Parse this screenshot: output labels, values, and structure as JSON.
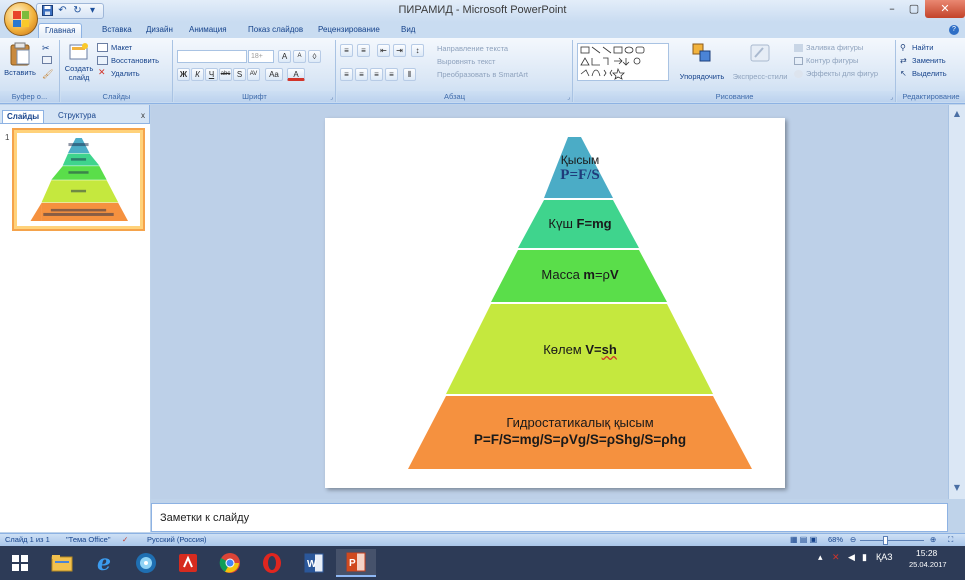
{
  "window": {
    "title": "ПИРАМИД - Microsoft PowerPoint",
    "controls": [
      "–",
      "▢",
      "✕"
    ]
  },
  "qat": {
    "icons": [
      "save-icon",
      "undo-icon",
      "redo-icon",
      "customize-icon"
    ]
  },
  "tabs": [
    {
      "label": "Главная",
      "active": true
    },
    {
      "label": "Вставка"
    },
    {
      "label": "Дизайн"
    },
    {
      "label": "Анимация"
    },
    {
      "label": "Показ слайдов"
    },
    {
      "label": "Рецензирование"
    },
    {
      "label": "Вид"
    }
  ],
  "ribbon": {
    "clipboard": {
      "label": "Буфер о...",
      "paste": "Вставить"
    },
    "slides": {
      "label": "Слайды",
      "new_slide_1": "Создать",
      "new_slide_2": "слайд",
      "layout": "Макет",
      "reset": "Восстановить",
      "delete": "Удалить"
    },
    "font": {
      "label": "Шрифт",
      "font_size": "18+",
      "bold": "Ж",
      "italic": "К",
      "underline": "Ч",
      "strike": "abc",
      "shadow": "S",
      "spacing": "AV",
      "case": "Aa",
      "color": "A"
    },
    "paragraph": {
      "label": "Абзац",
      "text_direction": "Направление текста",
      "align_text": "Выровнять текст",
      "smartart": "Преобразовать в SmartArt"
    },
    "drawing": {
      "label": "Рисование",
      "arrange": "Упорядочить",
      "quick_styles": "Экспресс-стили",
      "fill": "Заливка фигуры",
      "outline": "Контур фигуры",
      "effects": "Эффекты для фигур"
    },
    "editing": {
      "label": "Редактирование",
      "find": "Найти",
      "replace": "Заменить",
      "select": "Выделить"
    }
  },
  "left_pane": {
    "tab_slides": "Слайды",
    "tab_outline": "Структура",
    "close": "x",
    "slide_number": "1"
  },
  "slide": {
    "levels": [
      {
        "line1": "Қысым",
        "line2": "P=F/S",
        "color": "#4bacc6"
      },
      {
        "prefix": "Күш ",
        "formula": "F=mg",
        "color": "#3fd48d"
      },
      {
        "prefix": "Масса ",
        "formula_bold1": "m",
        "formula_mid": "=ρ",
        "formula_bold2": "V",
        "color": "#5ade4a"
      },
      {
        "prefix": "Көлем ",
        "formula": "V=",
        "formula_underlined": "sh",
        "color": "#c5e83e"
      },
      {
        "line1": "Гидростатикалық қысым",
        "line2": "P=F/S=mg/S=ρVg/S=ρShg/S=ρhg",
        "color": "#f5913f"
      }
    ]
  },
  "notes": {
    "placeholder": "Заметки к слайду"
  },
  "status": {
    "slide": "Слайд 1 из 1",
    "theme": "\"Тема Office\"",
    "language": "Русский (Россия)",
    "zoom": "68%"
  },
  "taskbar": {
    "apps": [
      "windows-start-icon",
      "file-explorer-icon",
      "internet-explorer-icon",
      "media-app-icon",
      "acrobat-icon",
      "chrome-icon",
      "opera-icon",
      "word-icon",
      "powerpoint-icon"
    ],
    "lang": "ҚАЗ",
    "time": "15:28",
    "date": "25.04.2017"
  }
}
